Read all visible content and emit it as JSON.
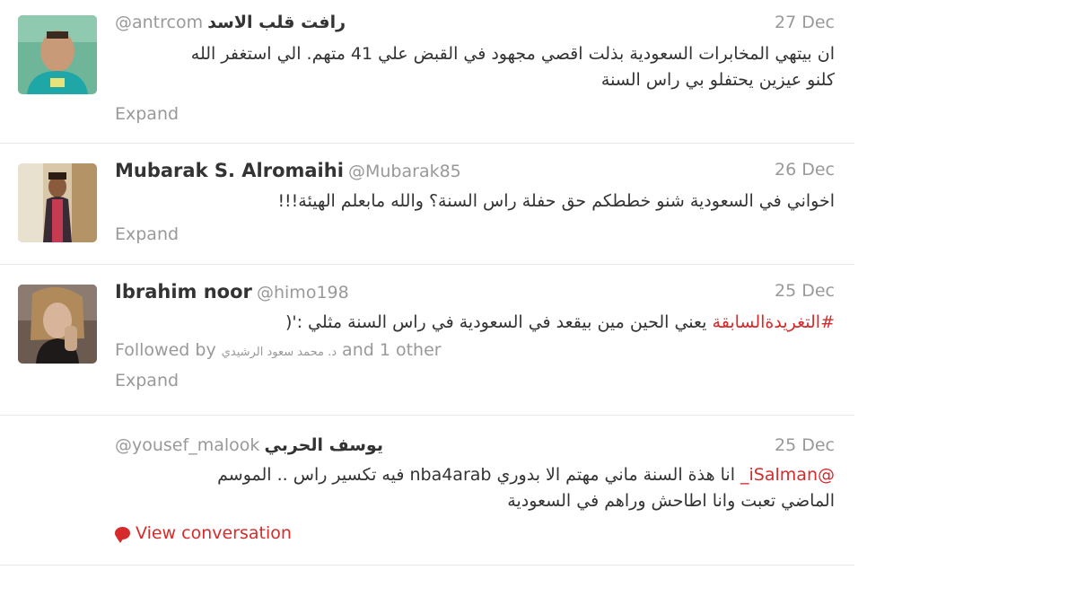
{
  "tweets": [
    {
      "name": "رافت قلب الاسد",
      "handle": "@antrcom",
      "date": "27 Dec",
      "text_line1": "ان بيتهي المخابرات السعودية بذلت اقصي مجهود في القبض علي 41 متهم. الي استغفر الله",
      "text_line2": "كلنو عيزين يحتفلو بي راس السنة",
      "expand": "Expand"
    },
    {
      "name": "Mubarak S. Alromaihi",
      "handle": "@Mubarak85",
      "date": "26 Dec",
      "text_line1": "اخواني في السعودية شنو خططكم حق حفلة راس السنة؟ والله مابعلم الهيئة!!!",
      "expand": "Expand"
    },
    {
      "name": "Ibrahim noor",
      "handle": "@himo198",
      "date": "25 Dec",
      "hashtag": "#التغريدةالسابقة",
      "text_rest": " يعني الحين مين بيقعد في السعودية في راس السنة مثلي :'(",
      "followed_prefix": "Followed by",
      "followed_name": "د. محمد سعود الرشيدي",
      "followed_suffix": "and 1 other",
      "expand": "Expand"
    },
    {
      "name": "يوسف الحربي",
      "handle": "@yousef_malook",
      "date": "25 Dec",
      "mention": "@iSalman_",
      "text_rest": " انا هذة السنة ماني مهتم الا بدوري nba4arab فيه تكسير راس .. الموسم",
      "text_line2": "الماضي تعبت وانا اطاحش وراهم في السعودية",
      "view_conversation": "View conversation"
    }
  ]
}
